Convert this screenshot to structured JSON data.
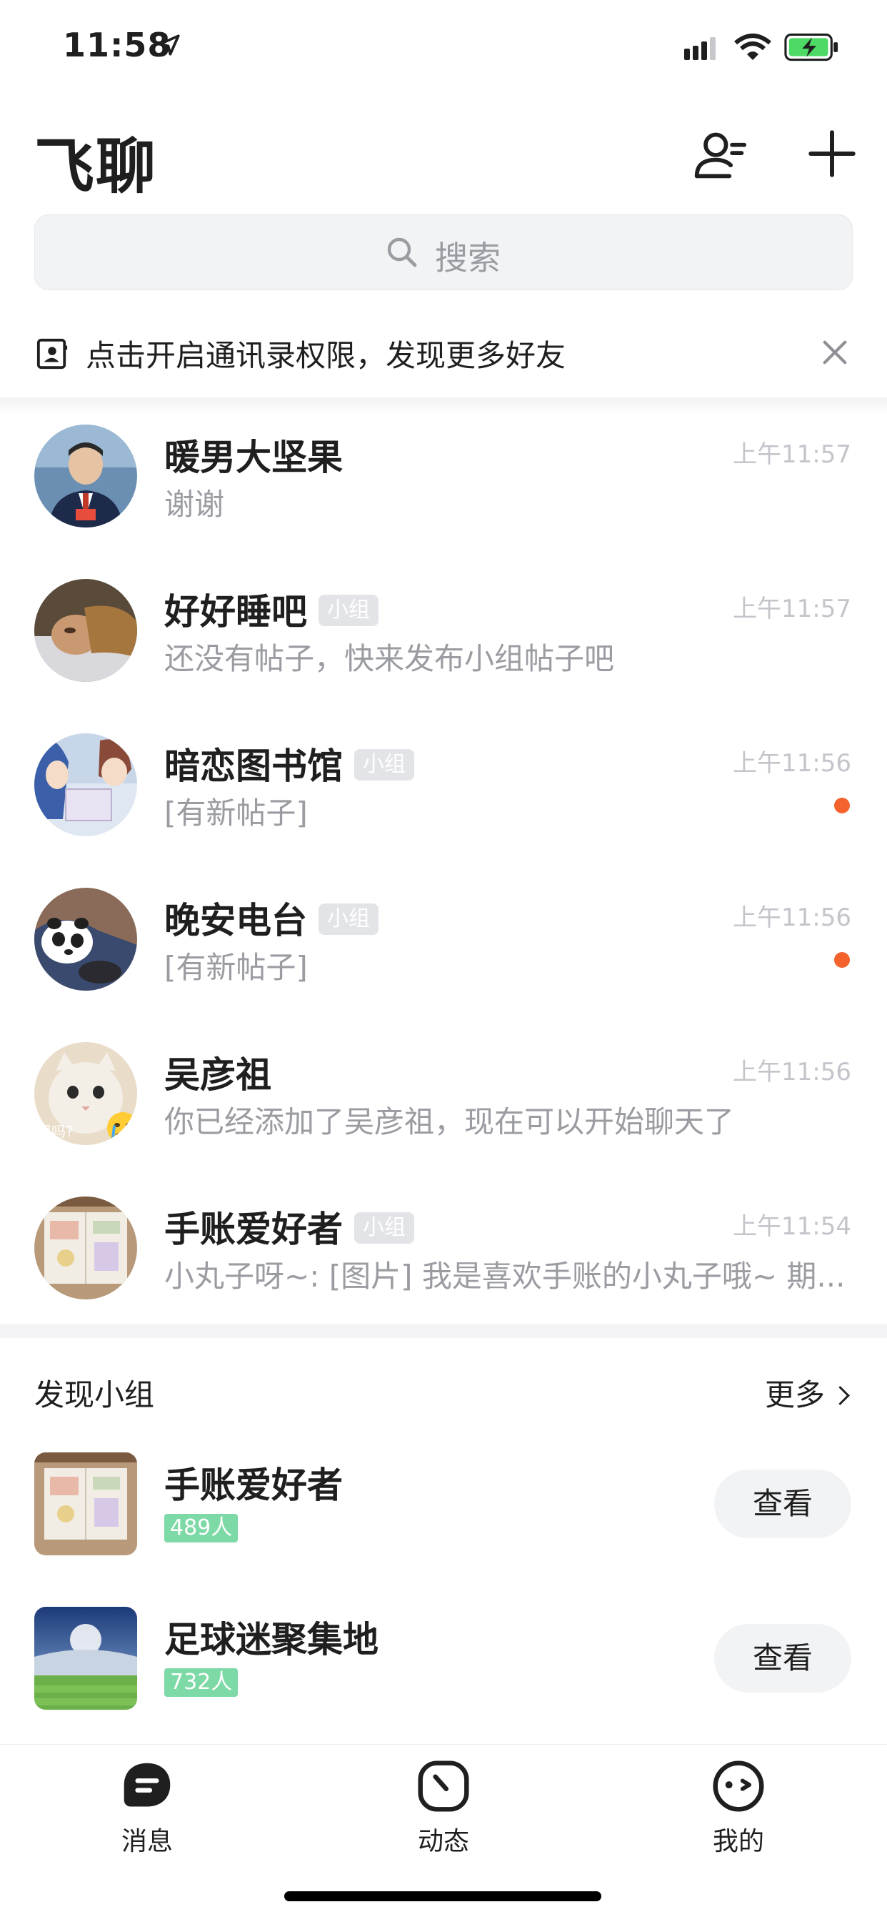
{
  "status": {
    "time": "11:58"
  },
  "header": {
    "title": "飞聊",
    "contacts_icon": "user-list-icon",
    "add_icon": "plus-icon"
  },
  "search": {
    "placeholder": "搜索"
  },
  "permission_bar": {
    "text": "点击开启通讯录权限，发现更多好友"
  },
  "chats": [
    {
      "name": "暖男大坚果",
      "badge": "",
      "message": "谢谢",
      "time": "上午11:57",
      "unread": false
    },
    {
      "name": "好好睡吧",
      "badge": "小组",
      "message": "还没有帖子，快来发布小组帖子吧",
      "time": "上午11:57",
      "unread": false
    },
    {
      "name": "暗恋图书馆",
      "badge": "小组",
      "message": "[有新帖子]",
      "time": "上午11:56",
      "unread": true
    },
    {
      "name": "晚安电台",
      "badge": "小组",
      "message": "[有新帖子]",
      "time": "上午11:56",
      "unread": true
    },
    {
      "name": "吴彦祖",
      "badge": "",
      "message": "你已经添加了吴彦祖，现在可以开始聊天了",
      "time": "上午11:56",
      "unread": false,
      "avatar_overlay": "居吗?"
    },
    {
      "name": "手账爱好者",
      "badge": "小组",
      "message": "小丸子呀~: [图片] 我是喜欢手账的小丸子哦~ 期...",
      "time": "上午11:54",
      "unread": false
    }
  ],
  "discover": {
    "title": "发现小组",
    "more": "更多",
    "groups": [
      {
        "name": "手账爱好者",
        "members": "489人",
        "action": "查看"
      },
      {
        "name": "足球迷聚集地",
        "members": "732人",
        "action": "查看"
      }
    ]
  },
  "tabs": [
    {
      "label": "消息",
      "icon": "chat-bubble-icon",
      "active": true
    },
    {
      "label": "动态",
      "icon": "clock-icon",
      "active": false
    },
    {
      "label": "我的",
      "icon": "face-icon",
      "active": false
    }
  ],
  "colors": {
    "unread_dot": "#f4622d",
    "member_badge": "#7dd9a5",
    "tag_badge": "#e3e4e7"
  }
}
